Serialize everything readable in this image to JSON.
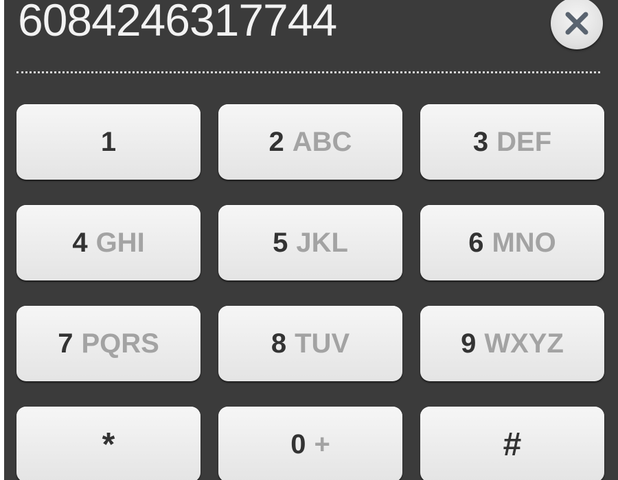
{
  "display": {
    "number": "6084246317744"
  },
  "clear_button": {
    "icon": "close-icon"
  },
  "keypad": {
    "keys": [
      {
        "digit": "1",
        "letters": ""
      },
      {
        "digit": "2",
        "letters": "ABC"
      },
      {
        "digit": "3",
        "letters": "DEF"
      },
      {
        "digit": "4",
        "letters": "GHI"
      },
      {
        "digit": "5",
        "letters": "JKL"
      },
      {
        "digit": "6",
        "letters": "MNO"
      },
      {
        "digit": "7",
        "letters": "PQRS"
      },
      {
        "digit": "8",
        "letters": "TUV"
      },
      {
        "digit": "9",
        "letters": "WXYZ"
      },
      {
        "digit": "*",
        "letters": ""
      },
      {
        "digit": "0",
        "letters": "+"
      },
      {
        "digit": "#",
        "letters": ""
      }
    ]
  },
  "colors": {
    "panel_background": "#3b3b3b",
    "key_background": "#efefef",
    "digit_text": "#333333",
    "letters_text": "#a3a3a3",
    "display_text": "#f2f2f2"
  }
}
